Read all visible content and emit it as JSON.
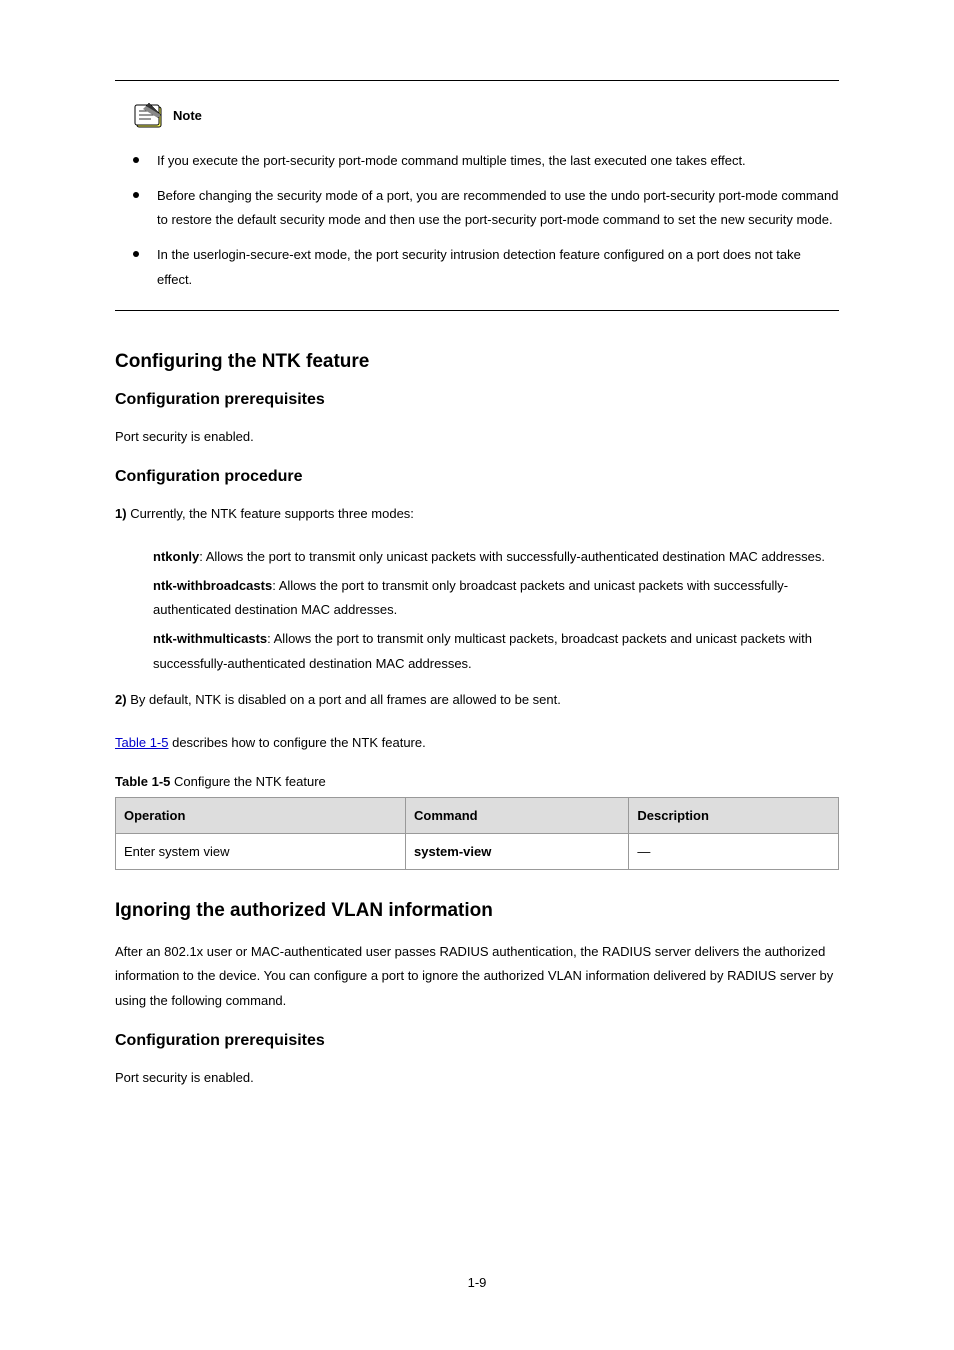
{
  "note_label": "Note",
  "bullets": [
    "If you execute the port-security port-mode command multiple times, the last executed one takes effect.",
    "Before changing the security mode of a port, you are recommended to use the undo port-security port-mode command to restore the default security mode and then use the port-security port-mode command to set the new security mode.",
    "In the userlogin-secure-ext mode, the port security intrusion detection feature configured on a port does not take effect."
  ],
  "heading_ntk": "Configuring the NTK feature",
  "heading_prereq": "Configuration prerequisites",
  "paragraph_prereq": "Port security is enabled.",
  "heading_procedure": "Configuration procedure",
  "numbered_intro_prefix": "Table 1-5",
  "numbered_intro_rest": " describes how to configure the NTK feature.",
  "table_caption_prefix": "Table 1-5 ",
  "table_caption_rest": "Configure the NTK feature",
  "table_headers": [
    "Operation",
    "Command",
    "Description"
  ],
  "table_row": [
    "Enter system view",
    "system-view",
    "—"
  ],
  "heading_ignore": "Ignoring the authorized VLAN information",
  "paragraph_ignore_1": "After an 802.1x user or MAC-authenticated user passes RADIUS authentication, the RADIUS server delivers the authorized information to the device. You can configure a port to ignore the authorized VLAN information delivered by RADIUS server by using the following command.",
  "heading_prereq2": "Configuration prerequisites",
  "paragraph_prereq2": "Port security is enabled.",
  "heading_sectionnum": "1)",
  "numbered_1_text": "Currently, the NTK feature supports three modes:",
  "ntk_modes": [
    {
      "label": "ntkonly",
      "desc": ": Allows the port to transmit only unicast packets with successfully-authenticated destination MAC addresses."
    },
    {
      "label": "ntk-withbroadcasts",
      "desc": ": Allows the port to transmit only broadcast packets and unicast packets with successfully-authenticated destination MAC addresses."
    },
    {
      "label": "ntk-withmulticasts",
      "desc": ": Allows the port to transmit only multicast packets, broadcast packets and unicast packets with successfully-authenticated destination MAC addresses."
    }
  ],
  "numbered_2_prefix": "2)",
  "numbered_2_text": "By default, NTK is disabled on a port and all frames are allowed to be sent.",
  "page_number": "1-9"
}
